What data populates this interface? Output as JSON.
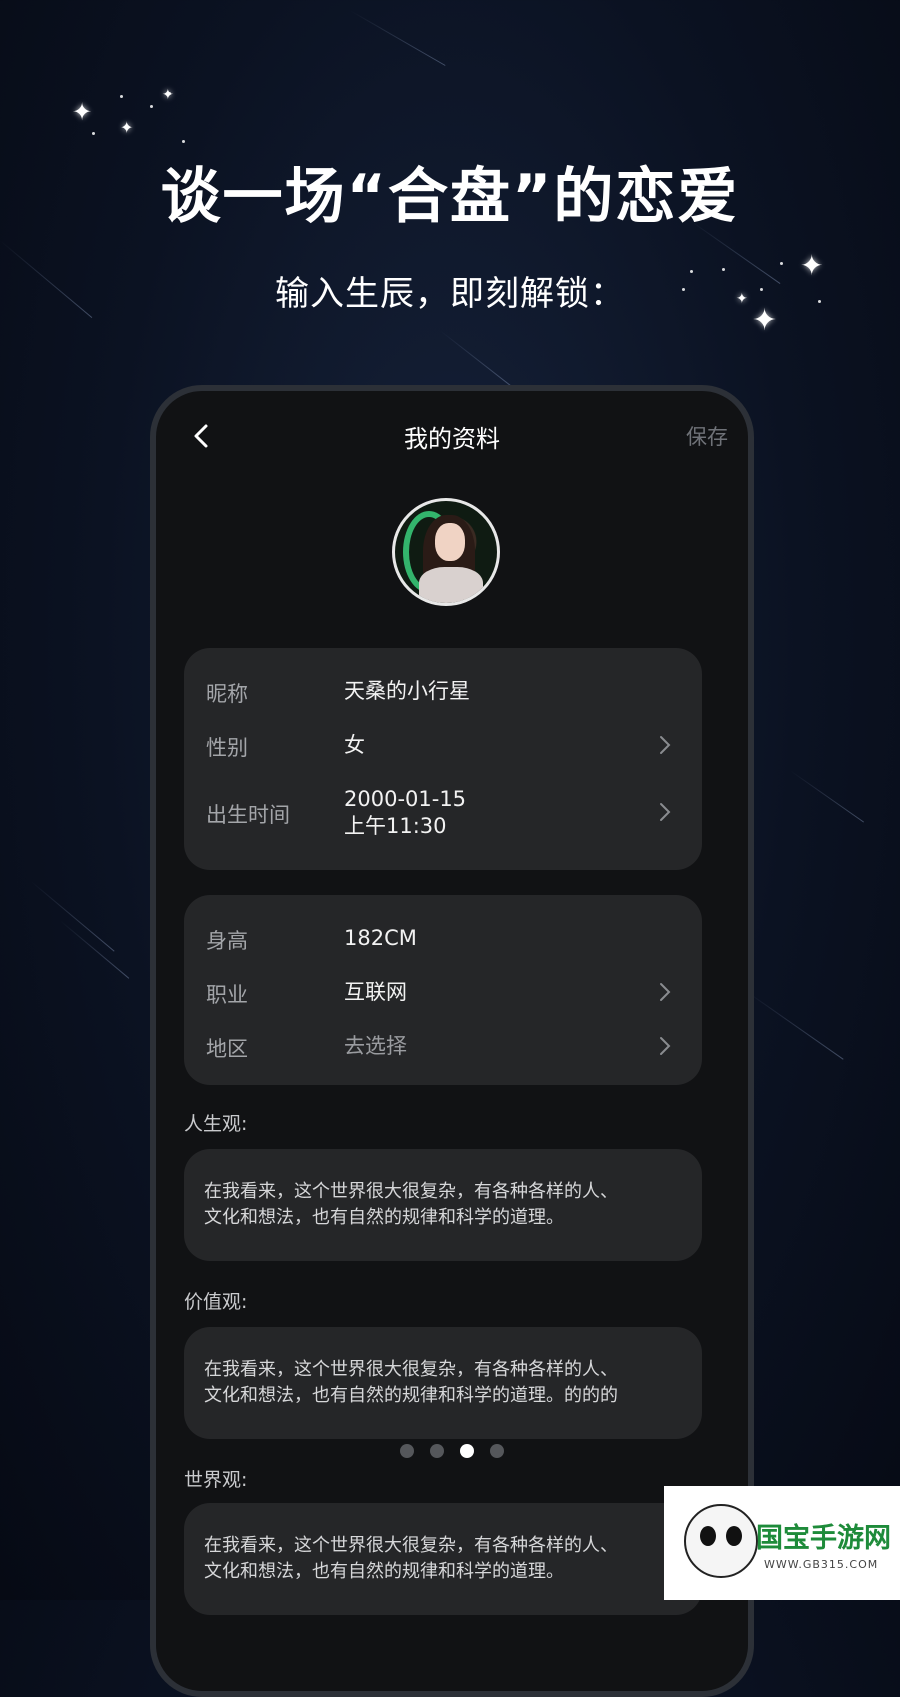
{
  "hero": {
    "title": "谈一场“合盘”的恋爱",
    "subtitle": "输入生辰，即刻解锁："
  },
  "nav": {
    "title": "我的资料",
    "save_label": "保存"
  },
  "profile_basic": [
    {
      "label": "昵称",
      "value": "天桑的小行星",
      "has_arrow": false
    },
    {
      "label": "性别",
      "value": "女",
      "has_arrow": true
    },
    {
      "label": "出生时间",
      "value_line1": "2000-01-15",
      "value_line2": "上午11:30",
      "has_arrow": true
    }
  ],
  "profile_extra": [
    {
      "label": "身高",
      "value": "182CM",
      "has_arrow": false
    },
    {
      "label": "职业",
      "value": "互联网",
      "has_arrow": true
    },
    {
      "label": "地区",
      "value": "去选择",
      "has_arrow": true,
      "is_placeholder": true
    }
  ],
  "outlook": {
    "life_label": "人生观:",
    "life_line1": "在我看来，这个世界很大很复杂，有各种各样的人、",
    "life_line2": "文化和想法，也有自然的规律和科学的道理。",
    "values_label": "价值观:",
    "values_line1": "在我看来，这个世界很大很复杂，有各种各样的人、",
    "values_line2": "文化和想法，也有自然的规律和科学的道理。的的的",
    "world_label": "世界观:",
    "world_line1": "在我看来，这个世界很大很复杂，有各种各样的人、",
    "world_line2": "文化和想法，也有自然的规律和科学的道理。"
  },
  "carousel": {
    "count": 4,
    "active_index": 2
  },
  "watermark": {
    "name": "国宝手游网",
    "url": "WWW.GB315.COM"
  },
  "colors": {
    "background": "#0b1222",
    "card": "#252628",
    "phone": "#111214",
    "watermark_green": "#1e8b3a"
  },
  "icons": [
    "back-arrow-icon",
    "chevron-right-icon",
    "star-icon",
    "panda-logo-icon"
  ]
}
